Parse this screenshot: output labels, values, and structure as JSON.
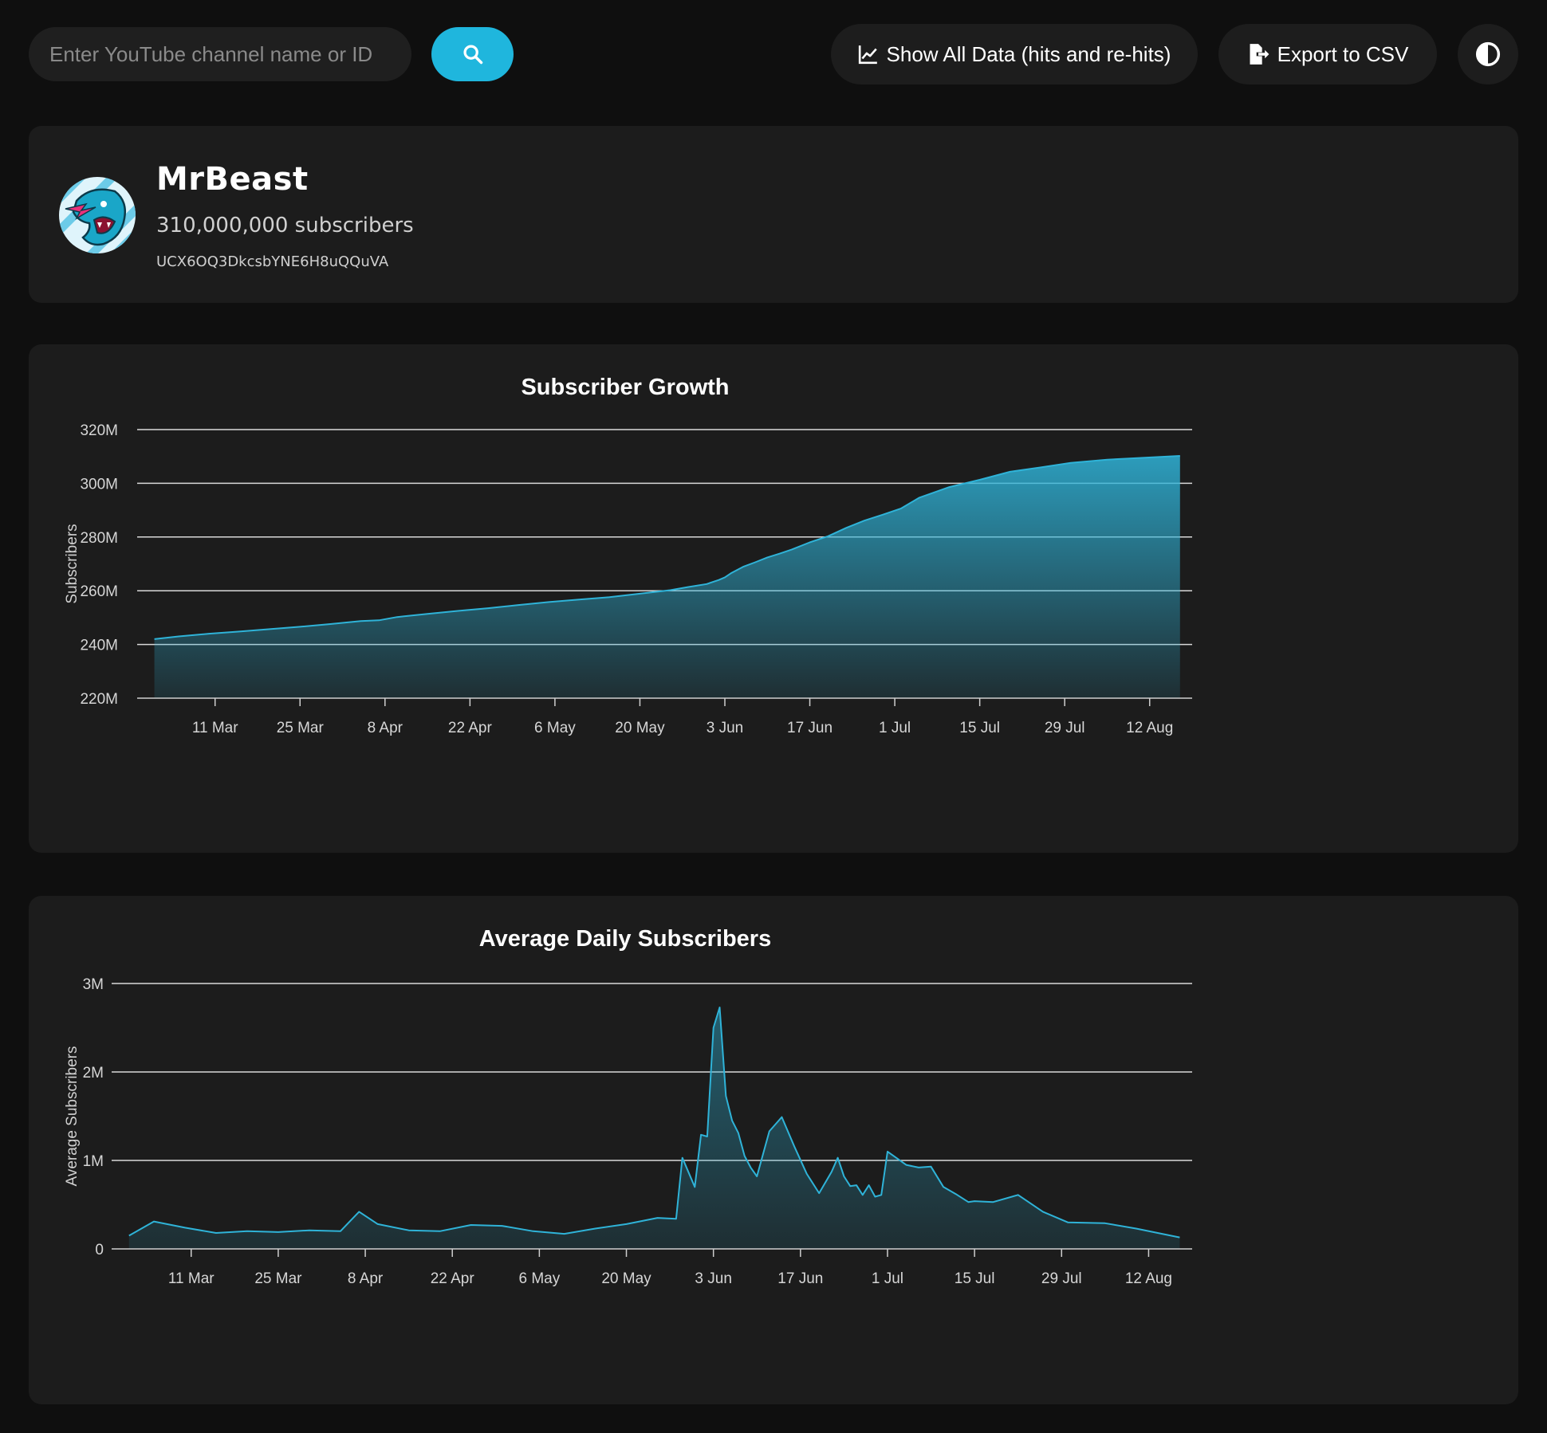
{
  "toolbar": {
    "search_placeholder": "Enter YouTube channel name or ID",
    "search_icon": "search-icon",
    "show_all_label": "Show All Data (hits and re-hits)",
    "show_all_icon": "line-chart-icon",
    "export_label": "Export to CSV",
    "export_icon": "file-export-icon",
    "theme_icon": "contrast-icon"
  },
  "channel": {
    "name": "MrBeast",
    "subscribers_text": "310,000,000 subscribers",
    "id": "UCX6OQ3DkcsbYNE6H8uQQuVA",
    "avatar": "mrbeast-panther-logo"
  },
  "colors": {
    "accent": "#1fb6dd",
    "line": "#2fb3d8",
    "background": "#0f0f0f",
    "card": "#1c1c1c",
    "pill": "#1d1d1d"
  },
  "chart_data": [
    {
      "type": "area",
      "title": "Subscriber Growth",
      "xlabel": "",
      "ylabel": "Subscribers",
      "x_ticks": [
        "11 Mar",
        "25 Mar",
        "8 Apr",
        "22 Apr",
        "6 May",
        "20 May",
        "3 Jun",
        "17 Jun",
        "1 Jul",
        "15 Jul",
        "29 Jul",
        "12 Aug"
      ],
      "y_ticks": [
        "220M",
        "240M",
        "260M",
        "280M",
        "300M",
        "320M"
      ],
      "ylim": [
        220000000,
        320000000
      ],
      "xlim": [
        "2024-02-29",
        "2024-08-19"
      ],
      "grid": true,
      "legend": "none",
      "x": [
        "2024-03-01",
        "2024-03-05",
        "2024-03-10",
        "2024-03-15",
        "2024-03-20",
        "2024-03-25",
        "2024-03-30",
        "2024-04-04",
        "2024-04-07",
        "2024-04-10",
        "2024-04-15",
        "2024-04-20",
        "2024-04-25",
        "2024-04-30",
        "2024-05-05",
        "2024-05-10",
        "2024-05-15",
        "2024-05-20",
        "2024-05-25",
        "2024-05-28",
        "2024-05-31",
        "2024-06-02",
        "2024-06-03",
        "2024-06-04",
        "2024-06-06",
        "2024-06-08",
        "2024-06-10",
        "2024-06-12",
        "2024-06-14",
        "2024-06-17",
        "2024-06-20",
        "2024-06-23",
        "2024-06-26",
        "2024-06-29",
        "2024-07-02",
        "2024-07-05",
        "2024-07-10",
        "2024-07-15",
        "2024-07-20",
        "2024-07-25",
        "2024-07-30",
        "2024-08-05",
        "2024-08-10",
        "2024-08-17"
      ],
      "values": [
        242000000,
        243000000,
        244000000,
        244800000,
        245700000,
        246600000,
        247600000,
        248700000,
        249000000,
        250200000,
        251400000,
        252500000,
        253500000,
        254700000,
        255800000,
        256700000,
        257600000,
        258900000,
        260200000,
        261400000,
        262500000,
        264000000,
        265000000,
        266500000,
        268900000,
        270600000,
        272400000,
        273800000,
        275300000,
        278000000,
        280300000,
        283400000,
        286100000,
        288300000,
        290600000,
        294600000,
        298600000,
        301300000,
        304300000,
        305900000,
        307600000,
        308800000,
        309400000,
        310200000
      ]
    },
    {
      "type": "area",
      "title": "Average Daily Subscribers",
      "xlabel": "",
      "ylabel": "Average Subscribers",
      "x_ticks": [
        "11 Mar",
        "25 Mar",
        "8 Apr",
        "22 Apr",
        "6 May",
        "20 May",
        "3 Jun",
        "17 Jun",
        "1 Jul",
        "15 Jul",
        "29 Jul",
        "12 Aug"
      ],
      "y_ticks": [
        "0",
        "1M",
        "2M",
        "3M"
      ],
      "ylim": [
        0,
        3000000
      ],
      "xlim": [
        "2024-02-29",
        "2024-08-19"
      ],
      "grid": true,
      "legend": "none",
      "x": [
        "2024-03-01",
        "2024-03-05",
        "2024-03-10",
        "2024-03-15",
        "2024-03-20",
        "2024-03-25",
        "2024-03-30",
        "2024-04-04",
        "2024-04-07",
        "2024-04-10",
        "2024-04-15",
        "2024-04-20",
        "2024-04-25",
        "2024-04-30",
        "2024-05-05",
        "2024-05-10",
        "2024-05-15",
        "2024-05-20",
        "2024-05-25",
        "2024-05-28",
        "2024-05-29",
        "2024-05-31",
        "2024-06-01",
        "2024-06-02",
        "2024-06-03",
        "2024-06-04",
        "2024-06-05",
        "2024-06-06",
        "2024-06-07",
        "2024-06-08",
        "2024-06-09",
        "2024-06-10",
        "2024-06-12",
        "2024-06-14",
        "2024-06-16",
        "2024-06-18",
        "2024-06-20",
        "2024-06-22",
        "2024-06-23",
        "2024-06-24",
        "2024-06-25",
        "2024-06-26",
        "2024-06-27",
        "2024-06-28",
        "2024-06-29",
        "2024-06-30",
        "2024-07-01",
        "2024-07-04",
        "2024-07-06",
        "2024-07-08",
        "2024-07-10",
        "2024-07-12",
        "2024-07-14",
        "2024-07-15",
        "2024-07-18",
        "2024-07-22",
        "2024-07-26",
        "2024-07-30",
        "2024-08-05",
        "2024-08-10",
        "2024-08-17"
      ],
      "values": [
        150000,
        310000,
        240000,
        180000,
        200000,
        190000,
        210000,
        200000,
        420000,
        280000,
        210000,
        200000,
        270000,
        260000,
        200000,
        170000,
        230000,
        280000,
        350000,
        340000,
        1030000,
        700000,
        1290000,
        1270000,
        2500000,
        2730000,
        1730000,
        1450000,
        1310000,
        1050000,
        920000,
        820000,
        1330000,
        1490000,
        1160000,
        850000,
        630000,
        870000,
        1030000,
        820000,
        710000,
        720000,
        610000,
        720000,
        590000,
        610000,
        1100000,
        950000,
        920000,
        930000,
        700000,
        620000,
        530000,
        540000,
        530000,
        610000,
        420000,
        300000,
        290000,
        230000,
        130000
      ]
    }
  ]
}
